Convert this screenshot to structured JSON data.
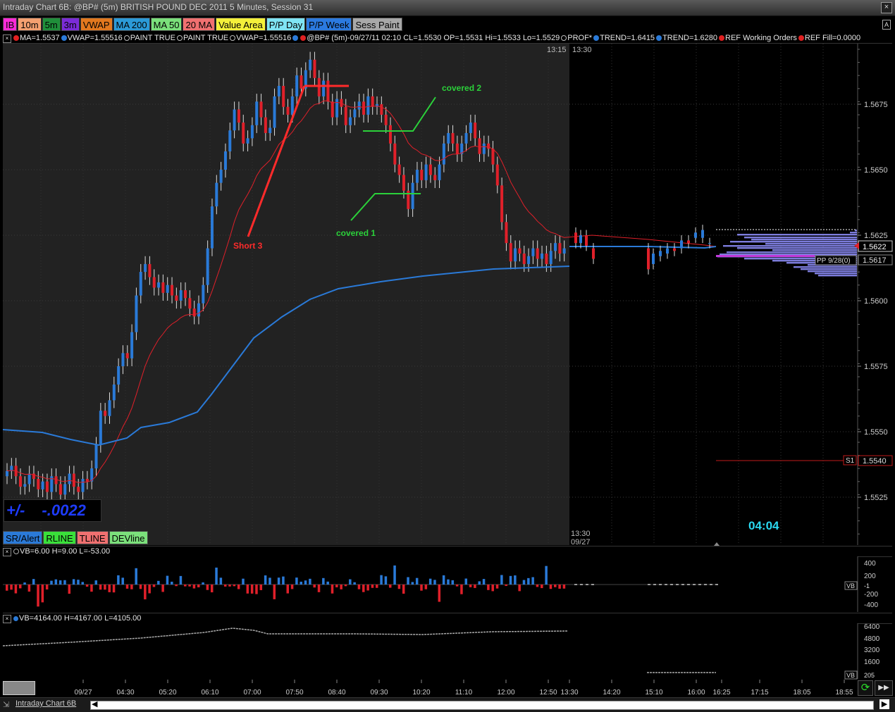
{
  "window": {
    "title": "Intraday Chart 6B: @BP# (5m) BRITISH POUND DEC 2011 5 Minutes, Session 31",
    "close_glyph": "×"
  },
  "toolbar": [
    {
      "label": "IB",
      "bg": "#ff2bd8"
    },
    {
      "label": "10m",
      "bg": "#f4a070"
    },
    {
      "label": "5m",
      "bg": "#1f8f3a"
    },
    {
      "label": "3m",
      "bg": "#7b2bd8"
    },
    {
      "label": "VWAP",
      "bg": "#e2781e"
    },
    {
      "label": "MA 200",
      "bg": "#2b9ad8"
    },
    {
      "label": "MA 50",
      "bg": "#7be07b"
    },
    {
      "label": "20 MA",
      "bg": "#f07070"
    },
    {
      "label": "Value Area",
      "bg": "#f4f03a"
    },
    {
      "label": "P/P Day",
      "bg": "#7fe4f4"
    },
    {
      "label": "P/P Week",
      "bg": "#2b7ae0"
    },
    {
      "label": "Sess Paint",
      "bg": "#a8a8a8"
    }
  ],
  "toolbar_right_icon": "A",
  "status_items": [
    {
      "text": "MA=1.5537",
      "dot": "#e02020"
    },
    {
      "text": "VWAP=1.55516",
      "dot": "#2a7ad8"
    },
    {
      "text": "PAINT TRUE",
      "dot": "#000000"
    },
    {
      "text": "PAINT TRUE",
      "dot": "#000000"
    },
    {
      "text": "VWAP=1.55516",
      "dot": "#000000"
    },
    {
      "text": "",
      "dot": "#2a7ad8"
    },
    {
      "text": "@BP# (5m)-09/27/11 02:10 CL=1.5530 OP=1.5531 Hi=1.5533 Lo=1.5529",
      "dot": "#e02020"
    },
    {
      "text": "PROF*",
      "dot": "#000000"
    },
    {
      "text": "TREND=1.6415",
      "dot": "#2a7ad8"
    },
    {
      "text": "TREND=1.6280",
      "dot": "#2a7ad8"
    },
    {
      "text": "REF Working Orders",
      "dot": "#e02020"
    },
    {
      "text": "REF Fill=0.0000",
      "dot": "#e02020"
    }
  ],
  "status_close": "×",
  "chart": {
    "price_labels": [
      "1.5675",
      "1.5650",
      "1.5625",
      "1.5600",
      "1.5575",
      "1.5550",
      "1.5525"
    ],
    "current_price": "1.5622",
    "pp_label": "PP 9/28(0)",
    "pp_value": "1.5617",
    "s1_label": "S1",
    "s1_value": "1.5540",
    "session_labels": [
      "13:15",
      "13:30"
    ],
    "session_bottom_time": "13:30",
    "session_bottom_date": "09/27",
    "timer": "04:04",
    "annotations": {
      "covered2": "covered 2",
      "covered1": "covered 1",
      "short3": "Short 3"
    }
  },
  "net_change": {
    "label": "+/-",
    "value": "-.0022"
  },
  "bottom_tabs": [
    {
      "label": "SR/Alert",
      "bg": "#2b7ad8"
    },
    {
      "label": "RLINE",
      "bg": "#3ae03a"
    },
    {
      "label": "TLINE",
      "bg": "#f07070"
    },
    {
      "label": "DEVline",
      "bg": "#7be07b"
    }
  ],
  "volume_panel": {
    "status": "VB=6.00 H=9.00 L=-53.00",
    "axis": [
      "400",
      "200",
      "-200",
      "-400"
    ],
    "vb_label": "VB",
    "vb_value": "-1"
  },
  "volume_panel2": {
    "status": "VB=4164.00 H=4167.00 L=4105.00",
    "axis": [
      "6400",
      "4800",
      "3200",
      "1600"
    ],
    "vb_label": "VB",
    "vb_value": "205"
  },
  "time_axis": [
    "09/27",
    "04:30",
    "05:20",
    "06:10",
    "07:00",
    "07:50",
    "08:40",
    "09:30",
    "10:20",
    "11:10",
    "12:00",
    "12:50",
    "13:30",
    "14:20",
    "15:10",
    "16:00",
    "16:25",
    "17:15",
    "18:05",
    "18:55"
  ],
  "footer": {
    "tab": "Intraday Chart 6B",
    "left_arrow": "◀",
    "right_arrow": "▶",
    "refresh_glyph": "⟳",
    "ffwd_glyph": "▶▶"
  }
}
